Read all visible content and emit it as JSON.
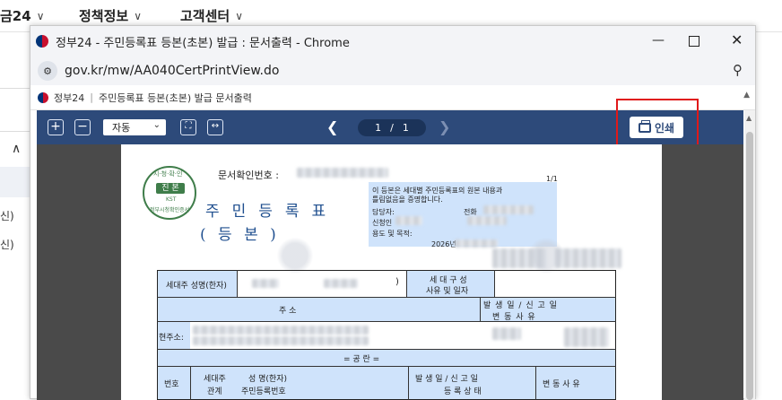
{
  "background": {
    "nav": [
      {
        "label": "금24"
      },
      {
        "label": "정책정보"
      },
      {
        "label": "고객센터"
      }
    ],
    "left_fragments": [
      "신)",
      "신)"
    ]
  },
  "window": {
    "title": "정부24 - 주민등록표 등본(초본) 발급 : 문서출력 - Chrome",
    "url": "gov.kr/mw/AA040CertPrintView.do",
    "page_brand": "정부24",
    "page_title": "주민등록표 등본(초본) 발급 문서출력"
  },
  "viewer": {
    "zoom_value": "자동",
    "current_page": "1",
    "page_separator": "/",
    "total_pages": "1",
    "print_label": "인쇄"
  },
  "document": {
    "doc_number_label": "문서확인번호 :",
    "page_count": "1/1",
    "seal_title": "진 본",
    "seal_code": "KST",
    "title_line1": "주민등록표",
    "title_line2": "( 등      본 )",
    "notice_text": "이 등본은 세대별 주민등록표의 원본 내용과",
    "notice_text2": "틀림없음을 증명합니다.",
    "label_official": "담당자:",
    "label_phone": "전화",
    "label_applicant": "신청인",
    "label_purpose": "용도 및 목적:",
    "issue_date": "2026년",
    "row_householder": "세대주 성명(한자)",
    "row_paren": ")",
    "row_composition": "세 대 구 성",
    "row_reason_date": "사유 및 일자",
    "col_address": "주                소",
    "col_event": "발 생 일 / 신 고 일",
    "col_change": "변 동 사 유",
    "col_event_short": "발  생  일   /   신  고  일",
    "col_change_short": "변    동    사    유",
    "row_current_address": "현주소:",
    "section_title": "=    공    란    =",
    "col_no": "번호",
    "col_relation": "세대주",
    "col_relation2": "관계",
    "col_name": "성  명(한자)",
    "col_rrn": "주민등록번호",
    "col_status": "등 록 상 태",
    "col_change2": "변 동 사 유"
  }
}
